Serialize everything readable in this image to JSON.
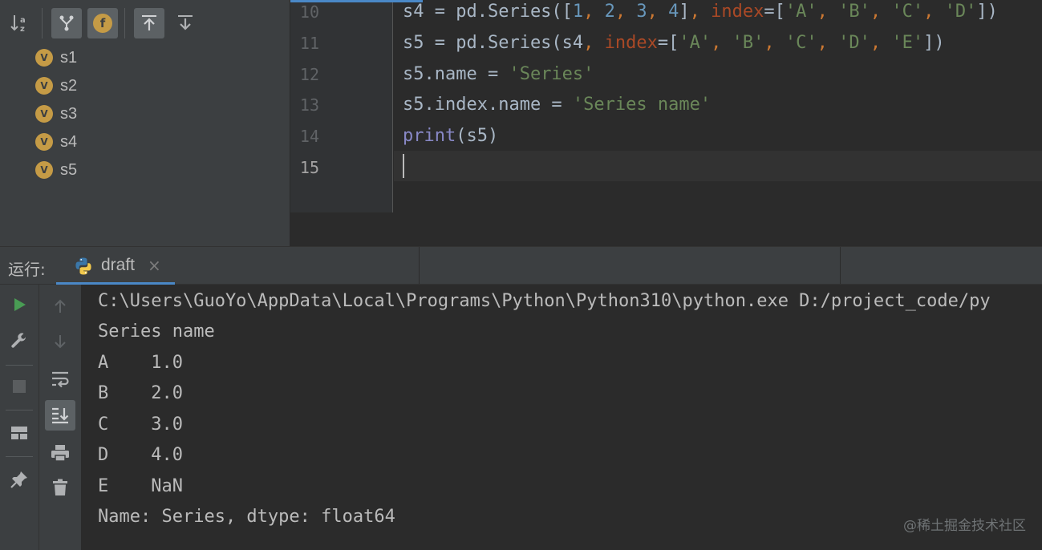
{
  "structure": {
    "toolbar": {
      "sort_icon": "sort-alphabetically-icon",
      "tree_icon": "show-inherited-icon",
      "fields_icon": "show-fields-icon",
      "fields_badge": "f",
      "expand_icon": "expand-all-icon",
      "collapse_icon": "collapse-all-icon"
    },
    "items": [
      {
        "badge": "V",
        "label": "s1"
      },
      {
        "badge": "V",
        "label": "s2"
      },
      {
        "badge": "V",
        "label": "s3"
      },
      {
        "badge": "V",
        "label": "s4"
      },
      {
        "badge": "V",
        "label": "s5"
      }
    ]
  },
  "editor": {
    "line_numbers": [
      "10",
      "11",
      "12",
      "13",
      "14",
      "15"
    ],
    "current_line": "15",
    "lines": [
      "s4 = pd.Series([1, 2, 3, 4], index=['A', 'B', 'C', 'D'])",
      "s5 = pd.Series(s4, index=['A', 'B', 'C', 'D', 'E'])",
      "s5.name = 'Series'",
      "s5.index.name = 'Series name'",
      "print(s5)",
      ""
    ]
  },
  "run": {
    "title": "运行:",
    "tab_label": "draft",
    "tab_close": "×",
    "output": [
      "C:\\Users\\GuoYo\\AppData\\Local\\Programs\\Python\\Python310\\python.exe D:/project_code/py",
      "Series name",
      "A    1.0",
      "B    2.0",
      "C    3.0",
      "D    4.0",
      "E    NaN",
      "Name: Series, dtype: float64"
    ],
    "watermark": "@稀土掘金技术社区"
  },
  "colors": {
    "accent": "#4a88c7",
    "run_green": "#499c54",
    "badge_gold": "#c59b46"
  }
}
